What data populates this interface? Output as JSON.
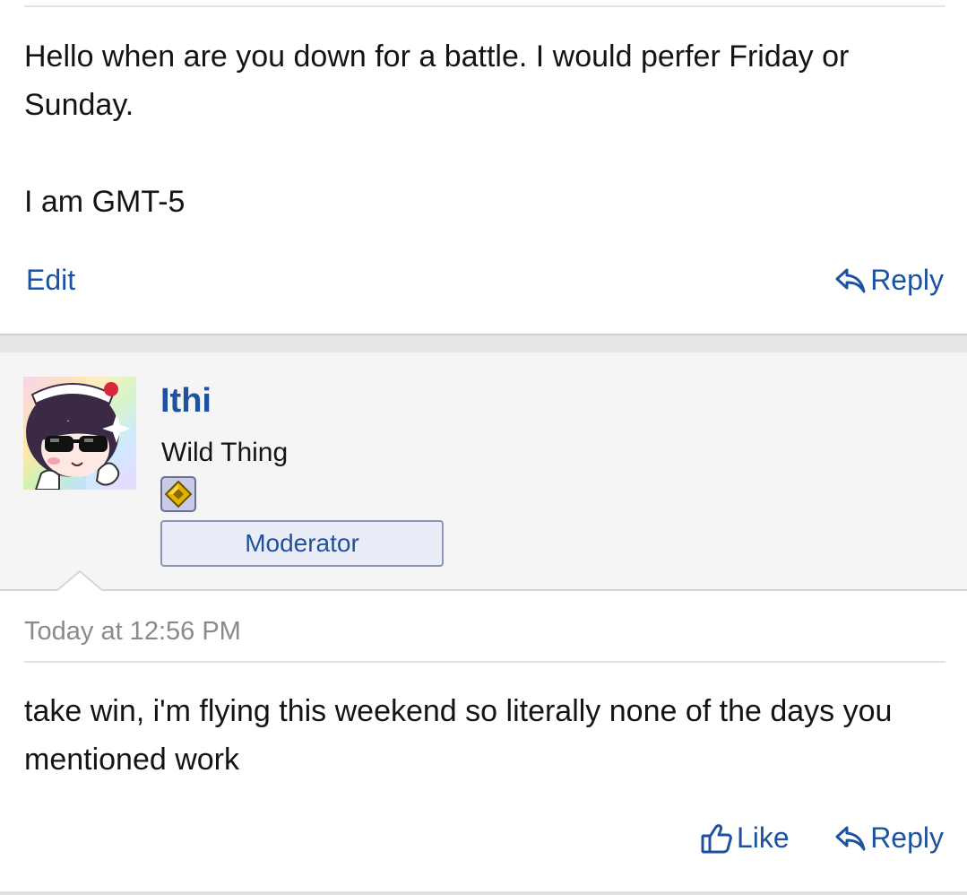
{
  "post1": {
    "message_line1": "Hello when are you down for a battle. I would perfer Friday or Sunday.",
    "message_line2": "I am GMT-5",
    "edit_label": "Edit",
    "reply_label": "Reply",
    "reply_icon": "reply-arrow-icon"
  },
  "post2": {
    "author": {
      "username": "Ithi",
      "user_title": "Wild Thing",
      "role_banner": "Moderator",
      "avatar": "anime-avatar-sunglasses",
      "badge_icon": "trophy-diamond-icon"
    },
    "timestamp": "Today at 12:56 PM",
    "message": "take win, i'm flying this weekend so literally none of the days you mentioned work",
    "like_label": "Like",
    "like_icon": "thumbs-up-icon",
    "reply_label": "Reply",
    "reply_icon": "reply-arrow-icon"
  },
  "colors": {
    "link": "#1d52a0",
    "text": "#141414",
    "muted": "#8a8a8a",
    "panel_bg": "#f5f5f5",
    "banner_bg": "#eaedf8",
    "banner_border": "#8b95b8"
  }
}
